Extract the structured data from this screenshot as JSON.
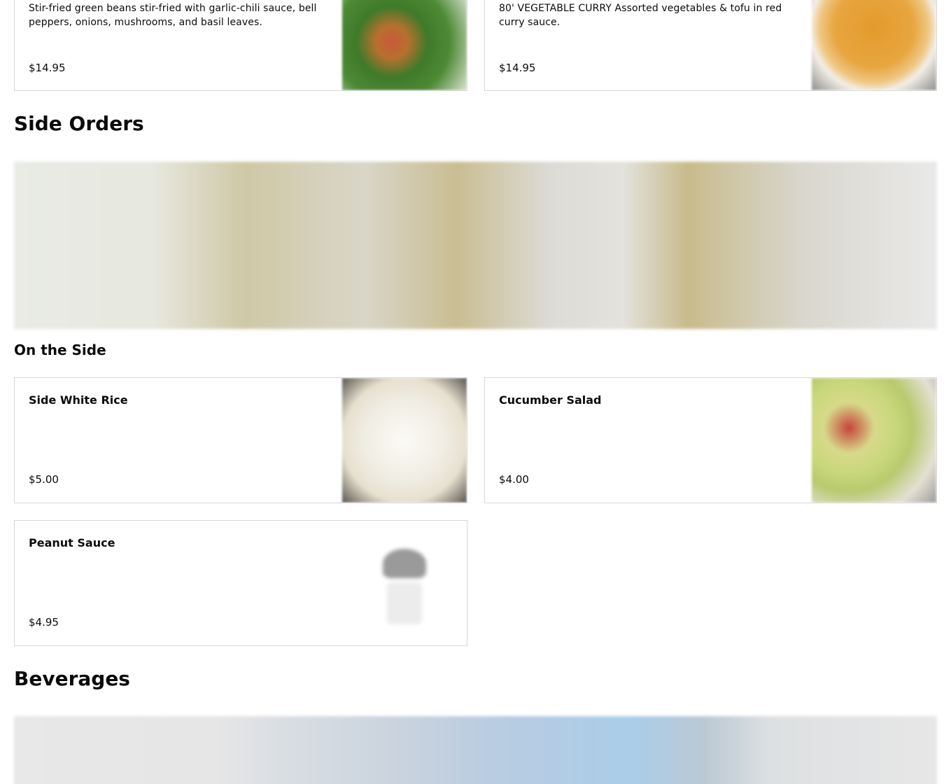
{
  "top_items": [
    {
      "description": "Stir-fried green beans stir-fried with garlic-chili sauce, bell peppers, onions, mushrooms, and basil leaves.",
      "price": "$14.95",
      "image": "green-beans-photo"
    },
    {
      "description": "80' VEGETABLE CURRY Assorted vegetables & tofu in red curry sauce.",
      "price": "$14.95",
      "image": "vegetable-curry-photo"
    }
  ],
  "side_orders": {
    "title": "Side Orders",
    "banner_image": "side-orders-banner-photo",
    "subsection": "On the Side",
    "items": [
      {
        "name": "Side White Rice",
        "price": "$5.00",
        "image": "white-rice-photo"
      },
      {
        "name": "Cucumber Salad",
        "price": "$4.00",
        "image": "cucumber-salad-photo"
      },
      {
        "name": "Peanut Sauce",
        "price": "$4.95",
        "image": "peanut-sauce-placeholder-icon"
      }
    ]
  },
  "beverages": {
    "title": "Beverages",
    "banner_image": "beverages-banner-photo"
  }
}
